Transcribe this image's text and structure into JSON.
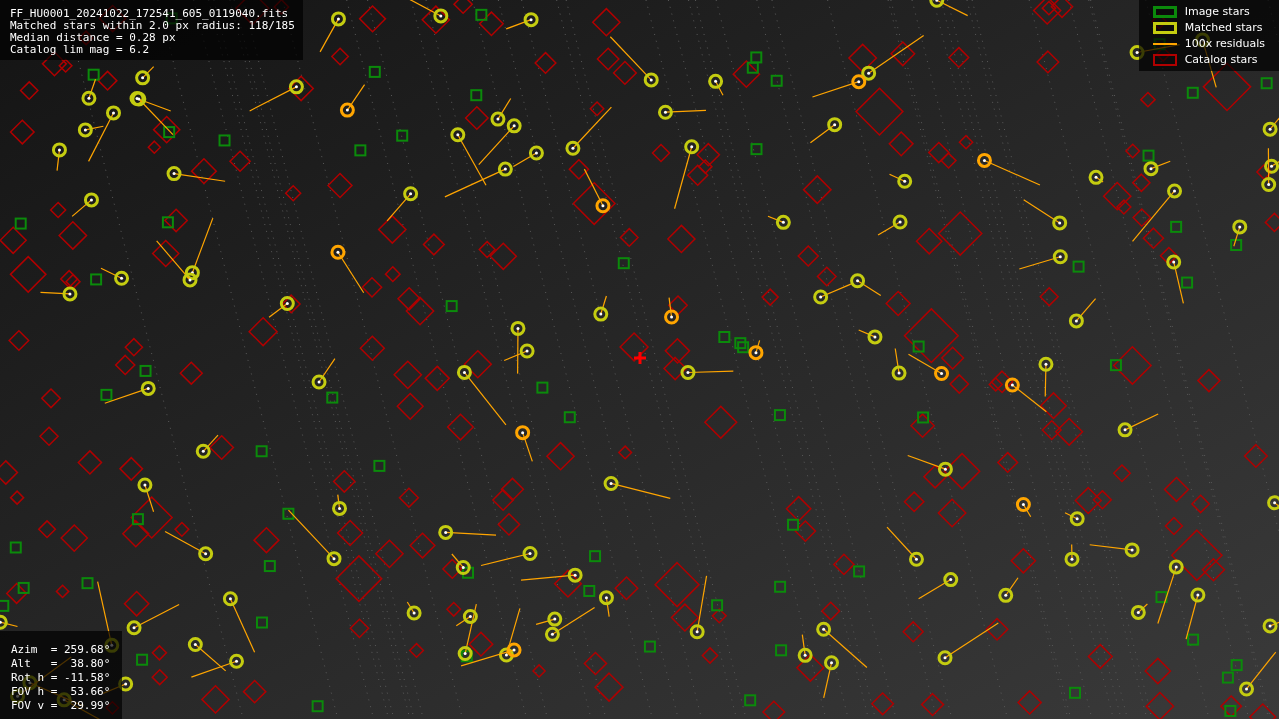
{
  "header": {
    "lines": [
      "FF_HU0001_20241022_172541_605_0119040.fits",
      "Matched stars within 2.0 px radius: 118/185",
      "Median distance = 0.28 px",
      "Catalog lim mag = 6.2"
    ]
  },
  "legend": [
    {
      "kind": "square",
      "label": "Image stars",
      "color": "#0b8a0b"
    },
    {
      "kind": "square",
      "label": "Matched stars",
      "color": "#c4cc10"
    },
    {
      "kind": "line",
      "label": "100x residuals",
      "color": "#ffa500"
    },
    {
      "kind": "diamond",
      "label": "Catalog stars",
      "color": "#b00000"
    }
  ],
  "info": {
    "lines": [
      "Azim  = 259.68°",
      "Alt   =  38.80°",
      "Rot h = -11.58°",
      "FOV h =  53.66°",
      "FOV v =  29.99°"
    ]
  }
}
